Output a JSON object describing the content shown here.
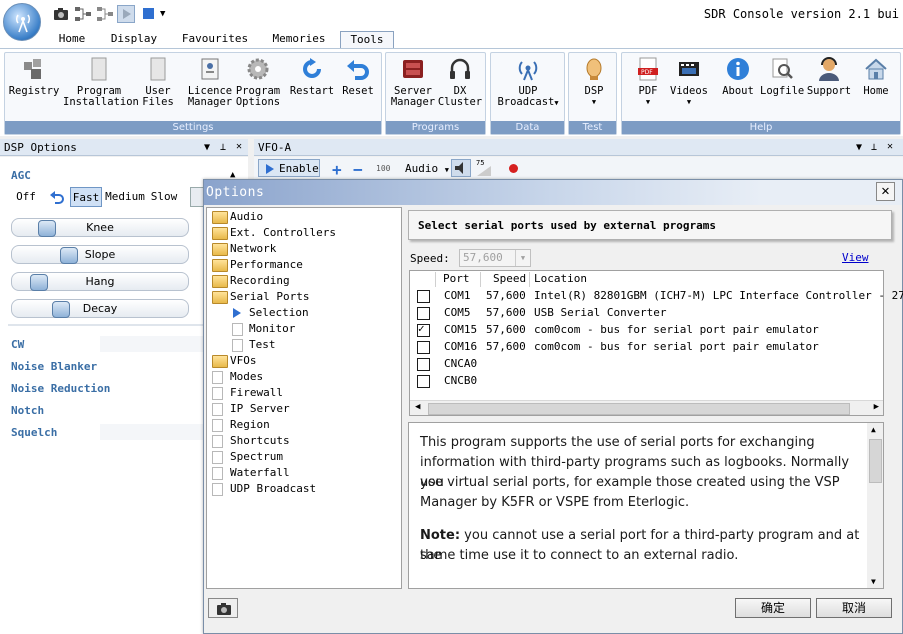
{
  "app": {
    "title": "SDR Console version 2.1 bui"
  },
  "tabs": [
    "Home",
    "Display",
    "Favourites",
    "Memories",
    "Tools"
  ],
  "ribbon": {
    "settings": {
      "label": "Settings",
      "buttons": [
        {
          "l1": "Registry",
          "l2": ""
        },
        {
          "l1": "Program",
          "l2": "Installation"
        },
        {
          "l1": "User",
          "l2": "Files"
        },
        {
          "l1": "Licence",
          "l2": "Manager"
        },
        {
          "l1": "Program",
          "l2": "Options"
        },
        {
          "l1": "Restart",
          "l2": ""
        },
        {
          "l1": "Reset",
          "l2": ""
        }
      ]
    },
    "programs": {
      "label": "Programs",
      "buttons": [
        {
          "l1": "Server",
          "l2": "Manager"
        },
        {
          "l1": "DX",
          "l2": "Cluster"
        }
      ]
    },
    "data": {
      "label": "Data",
      "buttons": [
        {
          "l1": "UDP",
          "l2": "Broadcast"
        }
      ]
    },
    "test": {
      "label": "Test",
      "buttons": [
        {
          "l1": "DSP",
          "l2": ""
        }
      ]
    },
    "help": {
      "label": "Help",
      "buttons": [
        {
          "l1": "PDF",
          "l2": ""
        },
        {
          "l1": "Videos",
          "l2": ""
        },
        {
          "l1": "About",
          "l2": ""
        },
        {
          "l1": "Logfile",
          "l2": ""
        },
        {
          "l1": "Support",
          "l2": ""
        },
        {
          "l1": "Home",
          "l2": ""
        }
      ]
    }
  },
  "dsp": {
    "title": "DSP Options",
    "agc_label": "AGC",
    "agc_modes": [
      "Off",
      "Fast",
      "Medium",
      "Slow"
    ],
    "agc_selected": "Fast",
    "sliders": [
      "Knee",
      "Slope",
      "Hang",
      "Decay"
    ],
    "sections": [
      "CW",
      "Noise Blanker",
      "Noise Reduction",
      "Notch",
      "Squelch"
    ]
  },
  "vfo": {
    "title": "VFO-A",
    "enable_label": "Enable",
    "step": "100",
    "audio_label": "Audio",
    "db": "75"
  },
  "dialog": {
    "title": "Options",
    "tree": [
      {
        "label": "Audio",
        "type": "folder",
        "indent": 0
      },
      {
        "label": "Ext. Controllers",
        "type": "folder",
        "indent": 0
      },
      {
        "label": "Network",
        "type": "folder",
        "indent": 0
      },
      {
        "label": "Performance",
        "type": "folder",
        "indent": 0
      },
      {
        "label": "Recording",
        "type": "folder",
        "indent": 0
      },
      {
        "label": "Serial Ports",
        "type": "folder-open",
        "indent": 0
      },
      {
        "label": "Selection",
        "type": "selected",
        "indent": 1
      },
      {
        "label": "Monitor",
        "type": "page",
        "indent": 1
      },
      {
        "label": "Test",
        "type": "page",
        "indent": 1
      },
      {
        "label": "VFOs",
        "type": "folder",
        "indent": 0
      },
      {
        "label": "Modes",
        "type": "page",
        "indent": 0
      },
      {
        "label": "Firewall",
        "type": "page",
        "indent": 0
      },
      {
        "label": "IP Server",
        "type": "page",
        "indent": 0
      },
      {
        "label": "Region",
        "type": "page",
        "indent": 0
      },
      {
        "label": "Shortcuts",
        "type": "page",
        "indent": 0
      },
      {
        "label": "Spectrum",
        "type": "page",
        "indent": 0
      },
      {
        "label": "Waterfall",
        "type": "page",
        "indent": 0
      },
      {
        "label": "UDP Broadcast",
        "type": "page",
        "indent": 0
      }
    ],
    "heading": "Select serial ports used by external programs",
    "speed_label": "Speed:",
    "speed_value": "57,600",
    "view_link": "View",
    "columns": [
      "Port",
      "Speed",
      "Location"
    ],
    "ports": [
      {
        "checked": false,
        "port": "COM1",
        "speed": "57,600",
        "location": "Intel(R) 82801GBM (ICH7-M) LPC Interface Controller - 27B9"
      },
      {
        "checked": false,
        "port": "COM5",
        "speed": "57,600",
        "location": "USB Serial Converter"
      },
      {
        "checked": true,
        "port": "COM15",
        "speed": "57,600",
        "location": "com0com - bus for serial port pair emulator"
      },
      {
        "checked": false,
        "port": "COM16",
        "speed": "57,600",
        "location": "com0com - bus for serial port pair emulator"
      },
      {
        "checked": false,
        "port": "CNCA0",
        "speed": "",
        "location": ""
      },
      {
        "checked": false,
        "port": "CNCB0",
        "speed": "",
        "location": ""
      }
    ],
    "help_lines": [
      "This program supports the use of serial ports for exchanging",
      "information with third-party programs such as logbooks. Normally you",
      "use virtual serial ports, for example those created using the VSP",
      "Manager by K5FR or VSPE from Eterlogic."
    ],
    "note_bold": "Note:",
    "note_lines": [
      " you cannot use a serial port for a third-party program and at the",
      "same time use it to connect to an external radio."
    ],
    "ok_label": "确定",
    "cancel_label": "取消"
  }
}
